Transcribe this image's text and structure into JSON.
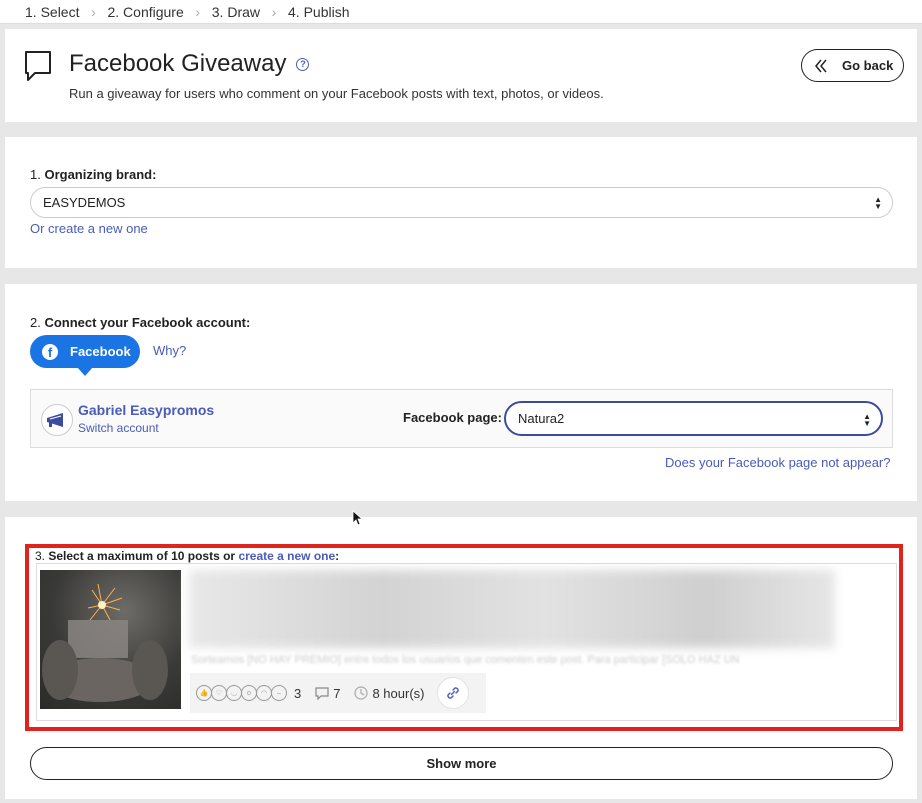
{
  "steps": [
    {
      "label": "1. Select"
    },
    {
      "label": "2. Configure"
    },
    {
      "label": "3. Draw"
    },
    {
      "label": "4. Publish"
    }
  ],
  "header": {
    "title": "Facebook Giveaway",
    "subtitle": "Run a giveaway for users who comment on your Facebook posts with text, photos, or videos.",
    "go_back_label": "Go back",
    "help_glyph": "?"
  },
  "brand_section": {
    "number": "1.",
    "label": "Organizing brand:",
    "selected": "EASYDEMOS",
    "create_link": "Or create a new one"
  },
  "connect_section": {
    "number": "2.",
    "label": "Connect your Facebook account:",
    "facebook_button": "Facebook",
    "why_link": "Why?",
    "account_name": "Gabriel Easypromos",
    "switch_account": "Switch account",
    "page_label": "Facebook page:",
    "page_selected": "Natura2",
    "page_missing_link": "Does your Facebook page not appear?"
  },
  "posts_section": {
    "number": "3.",
    "label": "Select a maximum of 10 posts or",
    "create_link": "create a new one",
    "suffix": ":",
    "post": {
      "preview_text": "Sorteamos [NO HAY PREMIO] entre todos los usuarios que comenten este post. Para participar [SOLO HAZ UN",
      "reactions_count": "3",
      "comments_count": "7",
      "time_ago": "8 hour(s)"
    },
    "show_more": "Show more"
  },
  "colors": {
    "accent": "#4a5bb8",
    "facebook_blue": "#1b74e4",
    "highlight_red": "#e0231c",
    "page_select_border": "#3d4a9e"
  },
  "icons": [
    "chevron-right-icon",
    "chat-bubble-icon",
    "help-icon",
    "double-chevron-left-icon",
    "facebook-icon",
    "megaphone-icon",
    "select-arrows-icon",
    "reaction-icons",
    "comment-icon",
    "clock-icon",
    "link-icon"
  ]
}
